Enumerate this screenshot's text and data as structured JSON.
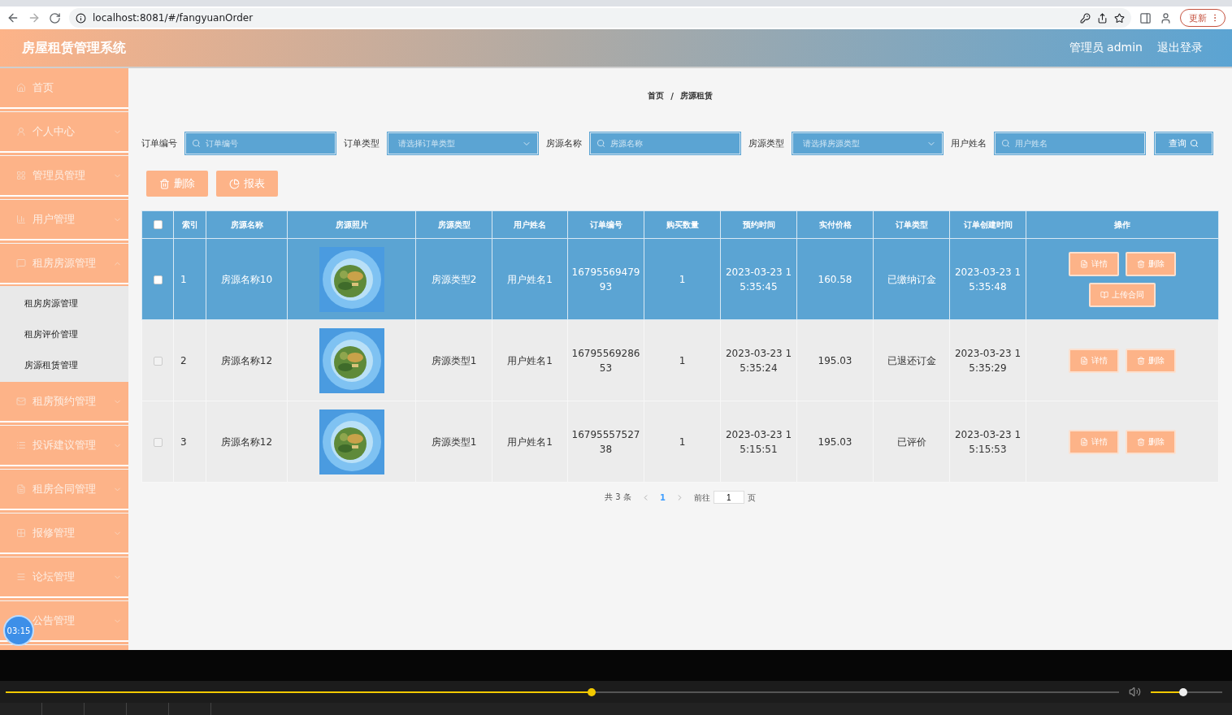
{
  "browser": {
    "url": "localhost:8081/#/fangyuanOrder",
    "update_button": "更新"
  },
  "header": {
    "title": "房屋租赁管理系统",
    "user": "管理员 admin",
    "logout": "退出登录"
  },
  "sidebar": {
    "items": [
      {
        "label": "首页",
        "kind": "link"
      },
      {
        "label": "个人中心",
        "kind": "menu",
        "expanded": false
      },
      {
        "label": "管理员管理",
        "kind": "menu",
        "expanded": false
      },
      {
        "label": "用户管理",
        "kind": "menu",
        "expanded": false
      },
      {
        "label": "租房房源管理",
        "kind": "menu",
        "expanded": true,
        "children": [
          {
            "label": "租房房源管理"
          },
          {
            "label": "租房评价管理"
          },
          {
            "label": "房源租赁管理"
          }
        ]
      },
      {
        "label": "租房预约管理",
        "kind": "menu",
        "expanded": false
      },
      {
        "label": "投诉建议管理",
        "kind": "menu",
        "expanded": false
      },
      {
        "label": "租房合同管理",
        "kind": "menu",
        "expanded": false
      },
      {
        "label": "报修管理",
        "kind": "menu",
        "expanded": false
      },
      {
        "label": "论坛管理",
        "kind": "menu",
        "expanded": false
      },
      {
        "label": "公告管理",
        "kind": "menu",
        "expanded": false
      }
    ]
  },
  "timer": "03:15",
  "breadcrumb": {
    "items": [
      "首页",
      "房源租赁"
    ],
    "separator": "/"
  },
  "filters": [
    {
      "label": "订单编号",
      "placeholder": "订单编号",
      "kind": "input"
    },
    {
      "label": "订单类型",
      "placeholder": "请选择订单类型",
      "kind": "select"
    },
    {
      "label": "房源名称",
      "placeholder": "房源名称",
      "kind": "input"
    },
    {
      "label": "房源类型",
      "placeholder": "请选择房源类型",
      "kind": "select"
    },
    {
      "label": "用户姓名",
      "placeholder": "用户姓名",
      "kind": "input"
    }
  ],
  "search_button": "查询",
  "toolbar": [
    {
      "label": "删除",
      "kind": "delete"
    },
    {
      "label": "报表",
      "kind": "report"
    }
  ],
  "table": {
    "select_all_checked": false,
    "columns": [
      "索引",
      "房源名称",
      "房源照片",
      "房源类型",
      "用户姓名",
      "订单编号",
      "购买数量",
      "预约时间",
      "实付价格",
      "订单类型",
      "订单创建时间",
      "操作"
    ],
    "rows": [
      {
        "selected": true,
        "checked": false,
        "index": "1",
        "name": "房源名称10",
        "photo": {
          "kind": "picture"
        },
        "type": "房源类型2",
        "user": "用户姓名1",
        "order_no": "1679556947993",
        "qty": "1",
        "booking_time": "2023-03-23 15:35:45",
        "price": "160.58",
        "order_type": "已缴纳订金",
        "created": "2023-03-23 15:35:48",
        "actions": [
          {
            "label": "详情",
            "kind": "detail"
          },
          {
            "label": "删除",
            "kind": "delete"
          },
          {
            "label": "上传合同",
            "kind": "upload"
          }
        ]
      },
      {
        "selected": false,
        "checked": false,
        "index": "2",
        "name": "房源名称12",
        "photo": {
          "kind": "picture"
        },
        "type": "房源类型1",
        "user": "用户姓名1",
        "order_no": "1679556928653",
        "qty": "1",
        "booking_time": "2023-03-23 15:35:24",
        "price": "195.03",
        "order_type": "已退还订金",
        "created": "2023-03-23 15:35:29",
        "actions": [
          {
            "label": "详情",
            "kind": "detail"
          },
          {
            "label": "删除",
            "kind": "delete"
          }
        ]
      },
      {
        "selected": false,
        "checked": false,
        "index": "3",
        "name": "房源名称12",
        "photo": {
          "kind": "picture"
        },
        "type": "房源类型1",
        "user": "用户姓名1",
        "order_no": "1679555752738",
        "qty": "1",
        "booking_time": "2023-03-23 15:15:51",
        "price": "195.03",
        "order_type": "已评价",
        "created": "2023-03-23 15:15:53",
        "actions": [
          {
            "label": "详情",
            "kind": "detail"
          },
          {
            "label": "删除",
            "kind": "delete"
          }
        ]
      }
    ]
  },
  "pagination": {
    "total": "共 3 条",
    "pages": [
      {
        "label": "1",
        "selected": true
      }
    ],
    "goto_label": "前往",
    "goto_value": "1",
    "page_suffix": "页"
  },
  "player": {
    "progress": {
      "level": 0.526
    },
    "volume": {
      "level": 0.45
    }
  }
}
